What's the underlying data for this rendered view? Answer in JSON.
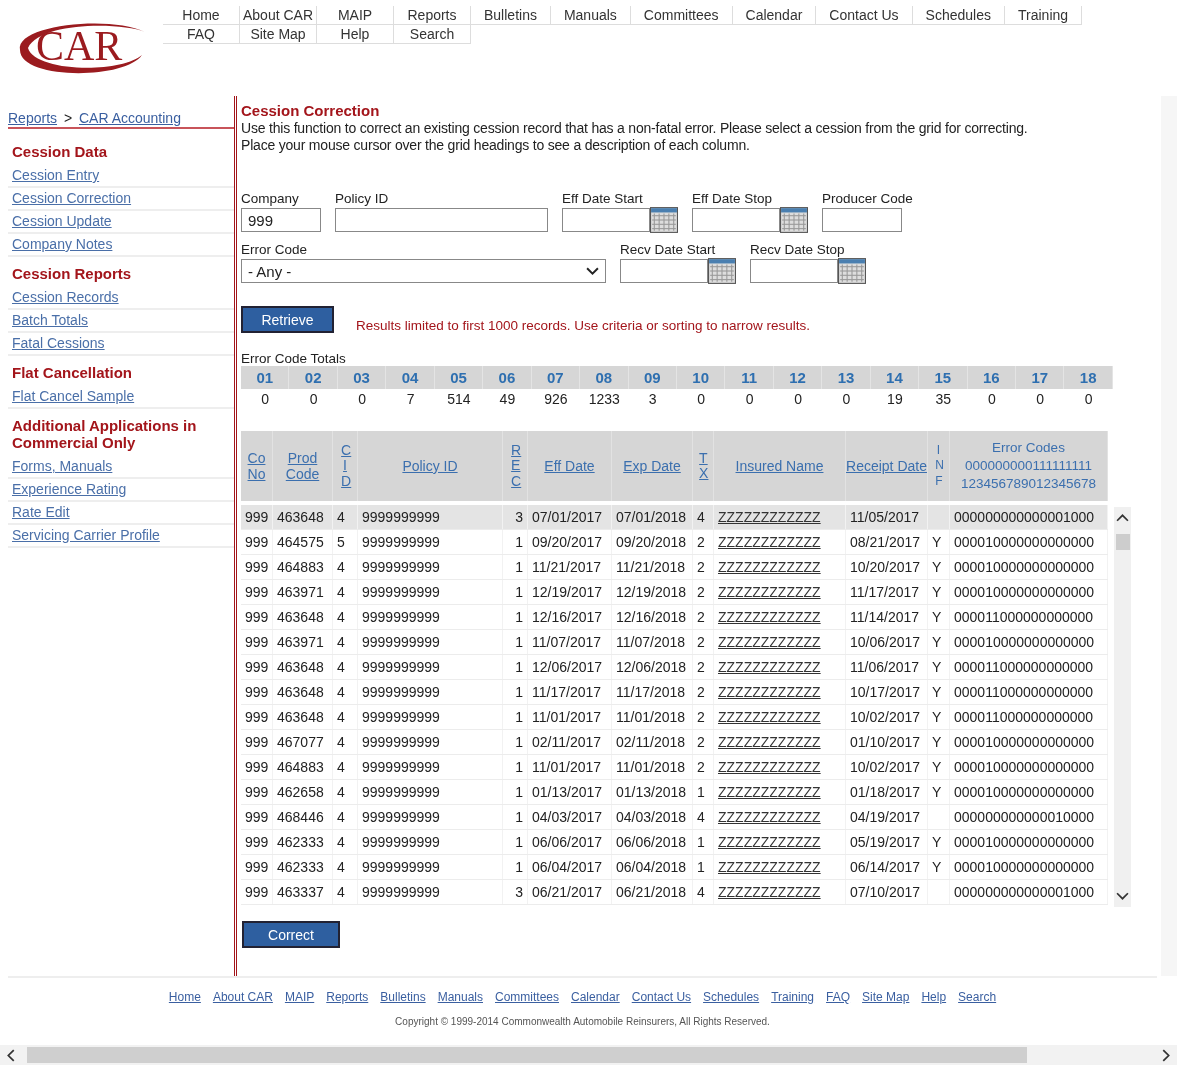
{
  "logo": "CAR",
  "nav_rows": [
    [
      "Home",
      "About CAR",
      "MAIP",
      "Reports",
      "Bulletins",
      "Manuals",
      "Committees",
      "Calendar",
      "Contact Us",
      "Schedules",
      "Training"
    ],
    [
      "FAQ",
      "Site Map",
      "Help",
      "Search"
    ]
  ],
  "breadcrumb": {
    "items": [
      "Reports",
      "CAR Accounting"
    ],
    "separator": ">"
  },
  "sidebar": [
    {
      "title": "Cession Data",
      "links": [
        "Cession Entry",
        "Cession Correction",
        "Cession Update",
        "Company Notes"
      ]
    },
    {
      "title": "Cession Reports",
      "links": [
        "Cession Records",
        "Batch Totals",
        "Fatal Cessions"
      ]
    },
    {
      "title": "Flat Cancellation",
      "links": [
        "Flat Cancel Sample"
      ]
    },
    {
      "title": "Additional Applications in Commercial Only",
      "links": [
        "Forms, Manuals",
        "Experience Rating",
        "Rate Edit",
        "Servicing Carrier Profile"
      ]
    }
  ],
  "title": "Cession Correction",
  "description": [
    "Use this function to correct an existing cession record that has a non-fatal error.  Please select a cession from the grid for correcting.",
    "Place your mouse cursor over the grid headings to see a description of each column."
  ],
  "filters": [
    [
      {
        "label": "Company",
        "value": "999",
        "kind": "short"
      },
      {
        "label": "Policy ID",
        "kind": "long"
      },
      {
        "label": "Eff Date Start",
        "kind": "date"
      },
      {
        "label": "Eff Date Stop",
        "kind": "date"
      },
      {
        "label": "Producer Code",
        "kind": "short"
      }
    ],
    [
      {
        "label": "Error Code",
        "value": "- Any -",
        "kind": "select"
      },
      {
        "label": "Recv Date Start",
        "kind": "date"
      },
      {
        "label": "Recv Date Stop",
        "kind": "date"
      }
    ]
  ],
  "retrieve_button": "Retrieve",
  "notice": "Results limited to first 1000 records. Use criteria or sorting to narrow results.",
  "totals": {
    "label": "Error Code Totals",
    "codes": [
      "01",
      "02",
      "03",
      "04",
      "05",
      "06",
      "07",
      "08",
      "09",
      "10",
      "11",
      "12",
      "13",
      "14",
      "15",
      "16",
      "17",
      "18"
    ],
    "values": [
      "0",
      "0",
      "0",
      "7",
      "514",
      "49",
      "926",
      "1233",
      "3",
      "0",
      "0",
      "0",
      "0",
      "19",
      "35",
      "0",
      "0",
      "0"
    ]
  },
  "grid": {
    "columns": [
      {
        "label": "Co No",
        "kind": "link"
      },
      {
        "label": "Prod Code",
        "kind": "link"
      },
      {
        "label": "CID",
        "kind": "vertical"
      },
      {
        "label": "Policy ID",
        "kind": "link"
      },
      {
        "label": "REC",
        "kind": "vertical"
      },
      {
        "label": "Eff Date",
        "kind": "link"
      },
      {
        "label": "Exp Date",
        "kind": "link"
      },
      {
        "label": "TX",
        "kind": "vertical"
      },
      {
        "label": "Insured Name",
        "kind": "link"
      },
      {
        "label": "Receipt Date",
        "kind": "link"
      },
      {
        "label": "INF",
        "kind": "plain"
      },
      {
        "label": "Error Codes",
        "lines": [
          "000000000111111111",
          "123456789012345678"
        ],
        "kind": "codes"
      }
    ],
    "rows": [
      {
        "selected": true,
        "cells": [
          "999",
          "463648",
          "4",
          "9999999999",
          "3",
          "07/01/2017",
          "07/01/2018",
          "4",
          "ZZZZZZZZZZZZ",
          "11/05/2017",
          "",
          "000000000000001000"
        ]
      },
      {
        "selected": false,
        "cells": [
          "999",
          "464575",
          "5",
          "9999999999",
          "1",
          "09/20/2017",
          "09/20/2018",
          "2",
          "ZZZZZZZZZZZZ",
          "08/21/2017",
          "Y",
          "000010000000000000"
        ]
      },
      {
        "selected": false,
        "cells": [
          "999",
          "464883",
          "4",
          "9999999999",
          "1",
          "11/21/2017",
          "11/21/2018",
          "2",
          "ZZZZZZZZZZZZ",
          "10/20/2017",
          "Y",
          "000010000000000000"
        ]
      },
      {
        "selected": false,
        "cells": [
          "999",
          "463971",
          "4",
          "9999999999",
          "1",
          "12/19/2017",
          "12/19/2018",
          "2",
          "ZZZZZZZZZZZZ",
          "11/17/2017",
          "Y",
          "000010000000000000"
        ]
      },
      {
        "selected": false,
        "cells": [
          "999",
          "463648",
          "4",
          "9999999999",
          "1",
          "12/16/2017",
          "12/16/2018",
          "2",
          "ZZZZZZZZZZZZ",
          "11/14/2017",
          "Y",
          "000011000000000000"
        ]
      },
      {
        "selected": false,
        "cells": [
          "999",
          "463971",
          "4",
          "9999999999",
          "1",
          "11/07/2017",
          "11/07/2018",
          "2",
          "ZZZZZZZZZZZZ",
          "10/06/2017",
          "Y",
          "000010000000000000"
        ]
      },
      {
        "selected": false,
        "cells": [
          "999",
          "463648",
          "4",
          "9999999999",
          "1",
          "12/06/2017",
          "12/06/2018",
          "2",
          "ZZZZZZZZZZZZ",
          "11/06/2017",
          "Y",
          "000011000000000000"
        ]
      },
      {
        "selected": false,
        "cells": [
          "999",
          "463648",
          "4",
          "9999999999",
          "1",
          "11/17/2017",
          "11/17/2018",
          "2",
          "ZZZZZZZZZZZZ",
          "10/17/2017",
          "Y",
          "000011000000000000"
        ]
      },
      {
        "selected": false,
        "cells": [
          "999",
          "463648",
          "4",
          "9999999999",
          "1",
          "11/01/2017",
          "11/01/2018",
          "2",
          "ZZZZZZZZZZZZ",
          "10/02/2017",
          "Y",
          "000011000000000000"
        ]
      },
      {
        "selected": false,
        "cells": [
          "999",
          "467077",
          "4",
          "9999999999",
          "1",
          "02/11/2017",
          "02/11/2018",
          "2",
          "ZZZZZZZZZZZZ",
          "01/10/2017",
          "Y",
          "000010000000000000"
        ]
      },
      {
        "selected": false,
        "cells": [
          "999",
          "464883",
          "4",
          "9999999999",
          "1",
          "11/01/2017",
          "11/01/2018",
          "2",
          "ZZZZZZZZZZZZ",
          "10/02/2017",
          "Y",
          "000010000000000000"
        ]
      },
      {
        "selected": false,
        "cells": [
          "999",
          "462658",
          "4",
          "9999999999",
          "1",
          "01/13/2017",
          "01/13/2018",
          "1",
          "ZZZZZZZZZZZZ",
          "01/18/2017",
          "Y",
          "000010000000000000"
        ]
      },
      {
        "selected": false,
        "cells": [
          "999",
          "468446",
          "4",
          "9999999999",
          "1",
          "04/03/2017",
          "04/03/2018",
          "4",
          "ZZZZZZZZZZZZ",
          "04/19/2017",
          "",
          "000000000000010000"
        ]
      },
      {
        "selected": false,
        "cells": [
          "999",
          "462333",
          "4",
          "9999999999",
          "1",
          "06/06/2017",
          "06/06/2018",
          "1",
          "ZZZZZZZZZZZZ",
          "05/19/2017",
          "Y",
          "000010000000000000"
        ]
      },
      {
        "selected": false,
        "cells": [
          "999",
          "462333",
          "4",
          "9999999999",
          "1",
          "06/04/2017",
          "06/04/2018",
          "1",
          "ZZZZZZZZZZZZ",
          "06/14/2017",
          "Y",
          "000010000000000000"
        ]
      },
      {
        "selected": false,
        "cells": [
          "999",
          "463337",
          "4",
          "9999999999",
          "3",
          "06/21/2017",
          "06/21/2018",
          "4",
          "ZZZZZZZZZZZZ",
          "07/10/2017",
          "",
          "000000000000001000"
        ]
      }
    ]
  },
  "correct_button": "Correct",
  "footer_links": [
    "Home",
    "About CAR",
    "MAIP",
    "Reports",
    "Bulletins",
    "Manuals",
    "Committees",
    "Calendar",
    "Contact Us",
    "Schedules",
    "Training",
    "FAQ",
    "Site Map",
    "Help",
    "Search"
  ],
  "copyright": "Copyright © 1999-2014 Commonwealth Automobile Reinsurers, All Rights Reserved."
}
